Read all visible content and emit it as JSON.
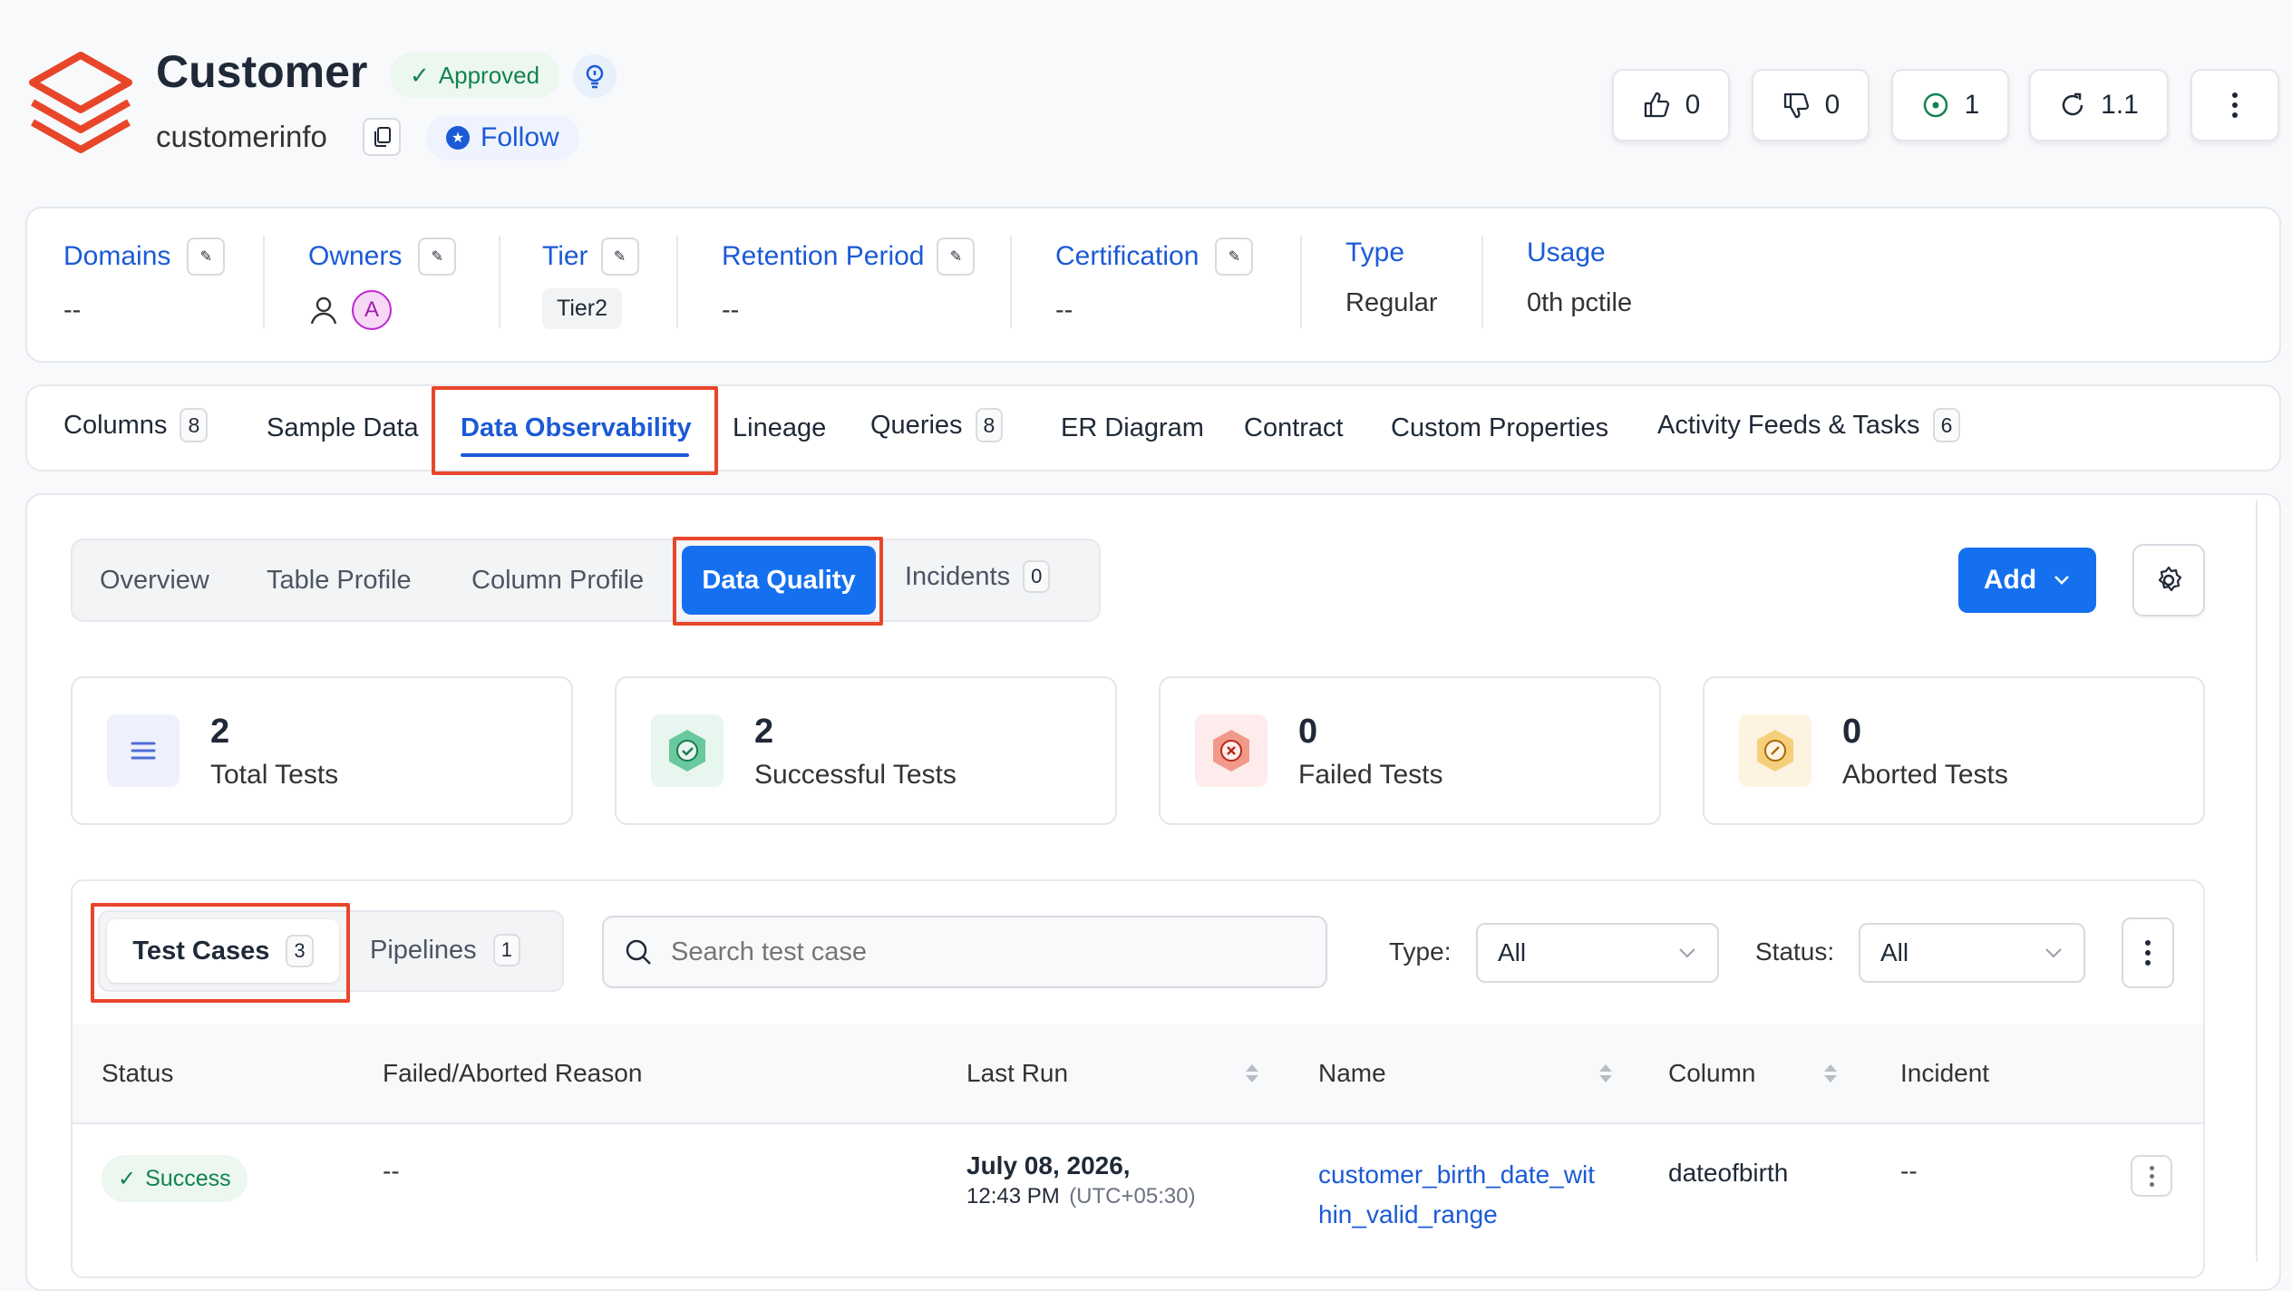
{
  "header": {
    "title": "Customer",
    "subtitle": "customerinfo",
    "status_badge": "Approved",
    "follow_label": "Follow",
    "actions": {
      "likes": "0",
      "dislikes": "0",
      "followers": "1",
      "version": "1.1"
    }
  },
  "properties": [
    {
      "label": "Domains",
      "value": "--"
    },
    {
      "label": "Owners",
      "avatar_letter": "A"
    },
    {
      "label": "Tier",
      "value": "Tier2"
    },
    {
      "label": "Retention Period",
      "value": "--"
    },
    {
      "label": "Certification",
      "value": "--"
    },
    {
      "label": "Type",
      "value": "Regular"
    },
    {
      "label": "Usage",
      "value": "0th pctile"
    }
  ],
  "tabs": [
    {
      "label": "Columns",
      "count": "8"
    },
    {
      "label": "Sample Data"
    },
    {
      "label": "Data Observability"
    },
    {
      "label": "Lineage"
    },
    {
      "label": "Queries",
      "count": "8"
    },
    {
      "label": "ER Diagram"
    },
    {
      "label": "Contract"
    },
    {
      "label": "Custom Properties"
    },
    {
      "label": "Activity Feeds & Tasks",
      "count": "6"
    }
  ],
  "subtabs": [
    {
      "label": "Overview"
    },
    {
      "label": "Table Profile"
    },
    {
      "label": "Column Profile"
    },
    {
      "label": "Data Quality"
    },
    {
      "label": "Incidents",
      "count": "0"
    }
  ],
  "add_button": "Add",
  "stats": [
    {
      "value": "2",
      "label": "Total Tests",
      "color": "#4f6bd6"
    },
    {
      "value": "2",
      "label": "Successful Tests",
      "color": "#1a9b6c"
    },
    {
      "value": "0",
      "label": "Failed Tests",
      "color": "#e5533d"
    },
    {
      "value": "0",
      "label": "Aborted Tests",
      "color": "#e9a23b"
    }
  ],
  "toggle": [
    {
      "label": "Test Cases",
      "count": "3"
    },
    {
      "label": "Pipelines",
      "count": "1"
    }
  ],
  "search": {
    "placeholder": "Search test case"
  },
  "filters": {
    "type_label": "Type:",
    "type_value": "All",
    "status_label": "Status:",
    "status_value": "All"
  },
  "table": {
    "headers": [
      "Status",
      "Failed/Aborted Reason",
      "Last Run",
      "Name",
      "Column",
      "Incident"
    ],
    "rows": [
      {
        "status": "Success",
        "reason": "--",
        "last_run_date": "July 08, 2026,",
        "last_run_time": "12:43 PM",
        "last_run_tz": "(UTC+05:30)",
        "name_line1": "customer_birth_date_wit",
        "name_line2": "hin_valid_range",
        "column": "dateofbirth",
        "incident": "--"
      }
    ]
  },
  "colors": {
    "accent": "#1b5ad6",
    "primary_button": "#1570ef",
    "highlight": "#e8462a",
    "success": "#12834f"
  }
}
